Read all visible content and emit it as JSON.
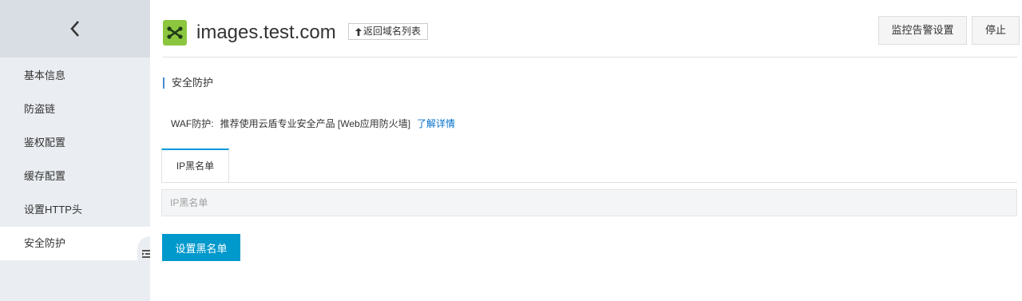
{
  "sidebar": {
    "back_icon": "chevron-left-icon",
    "items": [
      {
        "label": "基本信息",
        "active": false
      },
      {
        "label": "防盗链",
        "active": false
      },
      {
        "label": "鉴权配置",
        "active": false
      },
      {
        "label": "缓存配置",
        "active": false
      },
      {
        "label": "设置HTTP头",
        "active": false
      },
      {
        "label": "安全防护",
        "active": true
      }
    ],
    "collapse_icon": "collapse-menu-icon"
  },
  "header": {
    "logo_icon": "cdn-domain-icon",
    "title": "images.test.com",
    "back_list_label": "返回域名列表",
    "back_list_icon": "arrow-up-icon",
    "monitor_label": "监控告警设置",
    "stop_label": "停止"
  },
  "main": {
    "section_title": "安全防护",
    "waf": {
      "label": "WAF防护:",
      "text": "推荐使用云盾专业安全产品 [Web应用防火墙]",
      "link": "了解详情"
    },
    "tabs": [
      {
        "label": "IP黑名单",
        "active": true
      }
    ],
    "blacklist": {
      "value": "",
      "placeholder": "IP黑名单"
    },
    "set_blacklist_label": "设置黑名单"
  },
  "colors": {
    "accent": "#0099cc",
    "link": "#0070cc",
    "logo": "#8cc63f",
    "sidebar_bg": "#eaedf1"
  }
}
